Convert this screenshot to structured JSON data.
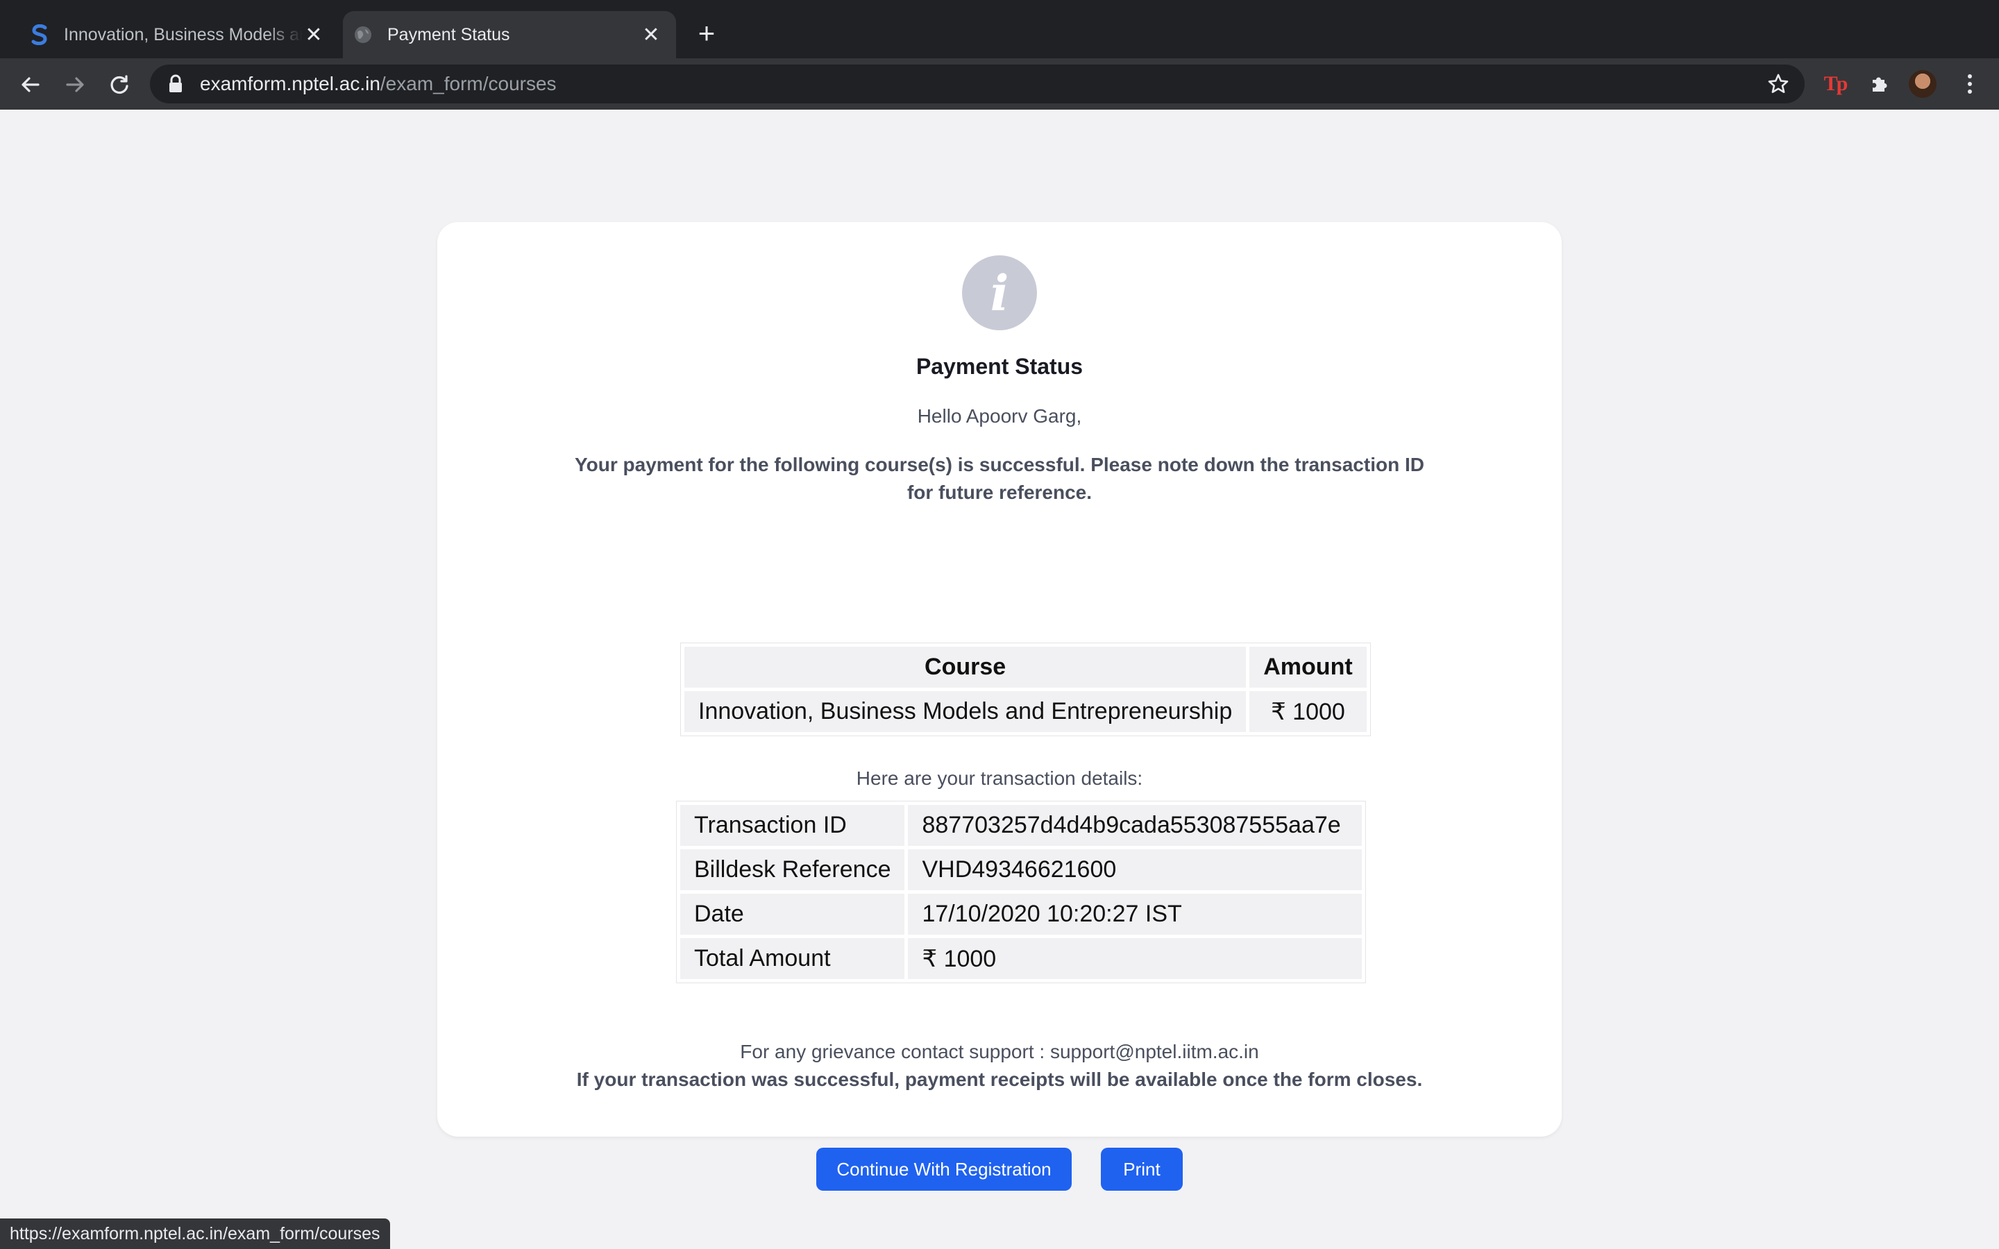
{
  "browser": {
    "tabs": [
      {
        "title": "Innovation, Business Models and Entrepreneurship",
        "favicon": "s-logo-icon",
        "active": false
      },
      {
        "title": "Payment Status",
        "favicon": "globe-icon",
        "active": true
      }
    ],
    "url_host": "examform.nptel.ac.in",
    "url_path": "/exam_form/courses",
    "status_url": "https://examform.nptel.ac.in/exam_form/courses",
    "extension_label": "Tp"
  },
  "page": {
    "icon": "info-icon",
    "icon_glyph": "i",
    "title": "Payment Status",
    "greeting": "Hello Apoorv Garg,",
    "message": "Your payment for the following course(s) is successful. Please note down the transaction ID for future reference.",
    "course_table": {
      "headers": [
        "Course",
        "Amount"
      ],
      "rows": [
        [
          "Innovation, Business Models and Entrepreneurship",
          "₹ 1000"
        ]
      ]
    },
    "details_caption": "Here are your transaction details:",
    "transaction": [
      {
        "label": "Transaction ID",
        "value": "887703257d4d4b9cada553087555aa7e"
      },
      {
        "label": "Billdesk Reference",
        "value": "VHD49346621600"
      },
      {
        "label": "Date",
        "value": "17/10/2020 10:20:27 IST"
      },
      {
        "label": "Total Amount",
        "value": "₹ 1000"
      }
    ],
    "support": "For any grievance contact support : support@nptel.iitm.ac.in",
    "receipt_note": "If your transaction was successful, payment receipts will be available once the form closes.",
    "buttons": {
      "continue": "Continue With Registration",
      "print": "Print"
    }
  },
  "colors": {
    "primary_button": "#1f62f0",
    "page_background": "#f2f2f4",
    "chrome_dark": "#202124"
  }
}
